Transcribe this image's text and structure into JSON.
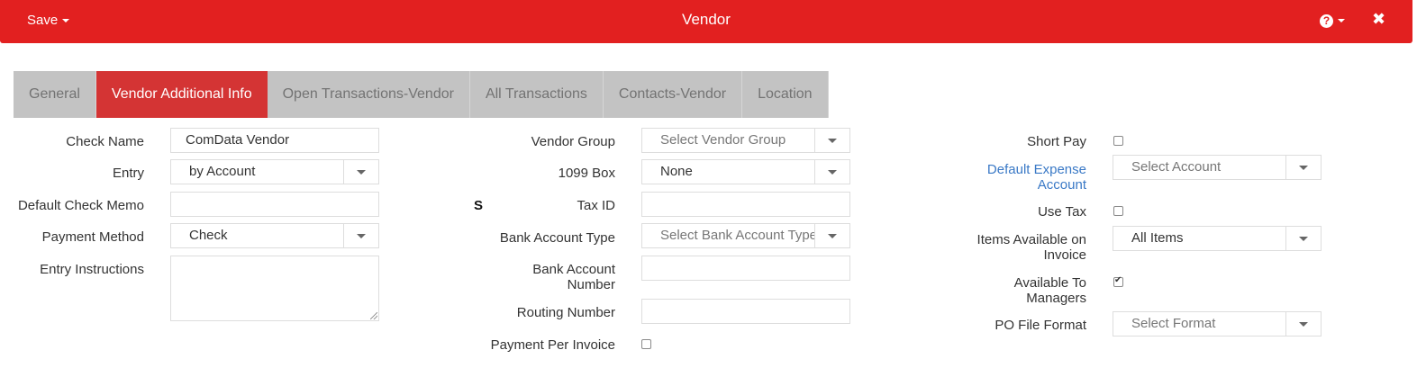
{
  "header": {
    "save_label": "Save",
    "title": "Vendor",
    "help_icon": "question-circle-icon",
    "close_icon": "close-icon",
    "accent_color": "#e22020"
  },
  "tabs": [
    {
      "label": "General",
      "active": false
    },
    {
      "label": "Vendor Additional Info",
      "active": true
    },
    {
      "label": "Open Transactions-Vendor",
      "active": false
    },
    {
      "label": "All Transactions",
      "active": false
    },
    {
      "label": "Contacts-Vendor",
      "active": false
    },
    {
      "label": "Location",
      "active": false
    }
  ],
  "col1": {
    "check_name": {
      "label": "Check Name",
      "value": "ComData Vendor"
    },
    "entry": {
      "label": "Entry",
      "value": "by Account"
    },
    "default_check_memo": {
      "label": "Default Check Memo",
      "value": ""
    },
    "payment_method": {
      "label": "Payment Method",
      "value": "Check"
    },
    "entry_instructions": {
      "label": "Entry Instructions",
      "value": ""
    }
  },
  "col2": {
    "vendor_group": {
      "label": "Vendor Group",
      "placeholder": "Select Vendor Group"
    },
    "box_1099": {
      "label": "1099 Box",
      "value": "None"
    },
    "marker": "S",
    "tax_id": {
      "label": "Tax ID",
      "value": ""
    },
    "bank_account_type": {
      "label": "Bank Account Type",
      "placeholder": "Select Bank Account Type"
    },
    "bank_account_number": {
      "label": "Bank Account Number",
      "value": ""
    },
    "routing_number": {
      "label": "Routing Number",
      "value": ""
    },
    "payment_per_invoice": {
      "label": "Payment Per Invoice",
      "checked": false
    }
  },
  "col3": {
    "short_pay": {
      "label": "Short Pay",
      "checked": false
    },
    "default_expense_account": {
      "label": "Default Expense Account",
      "placeholder": "Select Account"
    },
    "use_tax": {
      "label": "Use Tax",
      "checked": false
    },
    "items_available": {
      "label": "Items Available on Invoice",
      "value": "All Items"
    },
    "available_to_managers": {
      "label": "Available To Managers",
      "checked": true
    },
    "po_file_format": {
      "label": "PO File Format",
      "placeholder": "Select Format"
    }
  }
}
